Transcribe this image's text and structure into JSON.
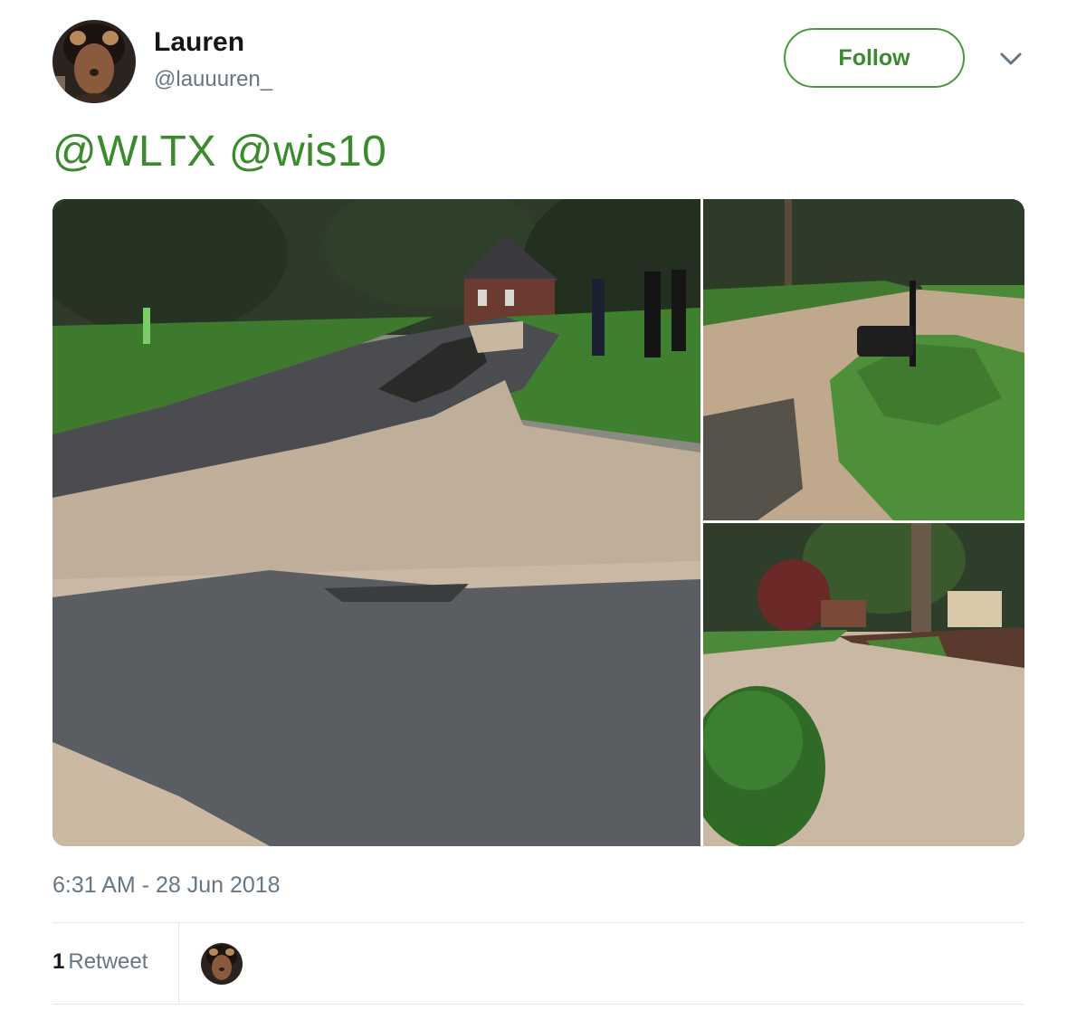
{
  "author": {
    "name": "Lauren",
    "handle": "@lauuuren_"
  },
  "actions": {
    "follow_label": "Follow",
    "more_icon": "chevron-down-icon"
  },
  "tweet": {
    "mentions": [
      "@WLTX",
      "@wis10"
    ],
    "timestamp": "6:31 AM - 28 Jun 2018"
  },
  "stats": {
    "retweet_count": "1",
    "retweet_label": "Retweet"
  },
  "colors": {
    "accent": "#3b8a2e",
    "text_primary": "#14171a",
    "text_secondary": "#657786",
    "divider": "#e1e8ed"
  }
}
